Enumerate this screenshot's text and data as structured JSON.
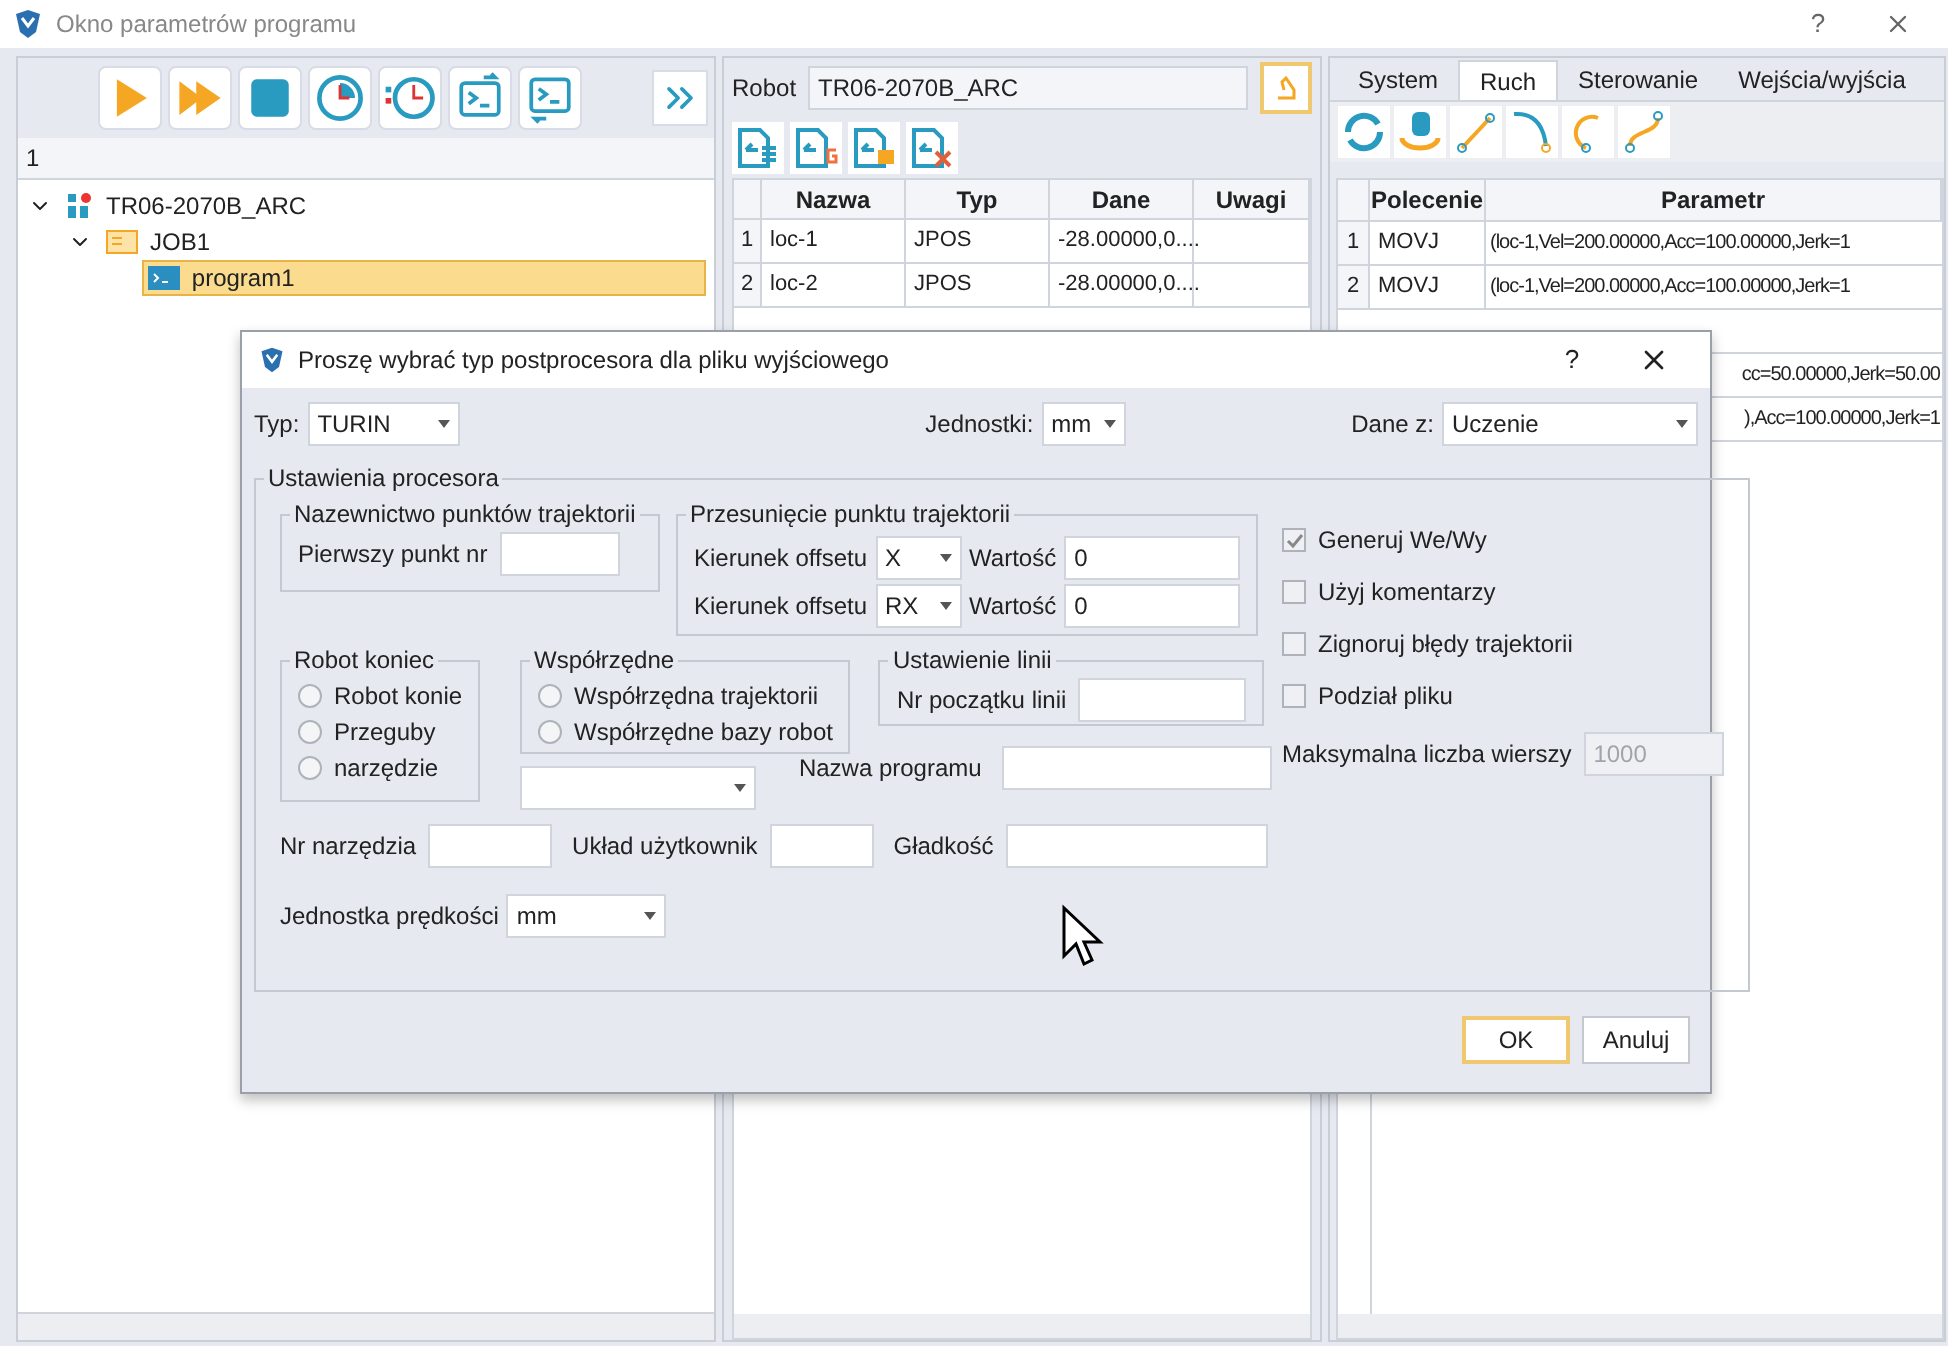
{
  "window": {
    "title": "Okno parametrów programu",
    "help": "?"
  },
  "left_panel": {
    "field": "1",
    "tree": [
      {
        "label": "TR06-2070B_ARC",
        "kind": "robot",
        "expanded": true,
        "selected": false,
        "children": [
          {
            "label": "JOB1",
            "kind": "folder",
            "expanded": true,
            "selected": false,
            "children": [
              {
                "label": "program1",
                "kind": "program",
                "selected": true
              }
            ]
          }
        ]
      }
    ]
  },
  "middle_panel": {
    "robot_label": "Robot",
    "robot_value": "TR06-2070B_ARC",
    "columns": [
      "Nazwa",
      "Typ",
      "Dane",
      "Uwagi"
    ],
    "rows": [
      {
        "number": "1",
        "cells": [
          "loc-1",
          "JPOS",
          "-28.00000,0...."
        ]
      },
      {
        "number": "2",
        "cells": [
          "loc-2",
          "JPOS",
          "-28.00000,0...."
        ]
      }
    ]
  },
  "right_panel": {
    "tabs": [
      {
        "label": "System",
        "selected": false
      },
      {
        "label": "Ruch",
        "selected": true
      },
      {
        "label": "Sterowanie",
        "selected": false
      },
      {
        "label": "Wejścia/wyjścia",
        "selected": false
      }
    ],
    "columns": [
      "Polecenie",
      "Parametr"
    ],
    "rows": [
      {
        "number": "1",
        "command": "MOVJ",
        "param": "(loc-1,Vel=200.00000,Acc=100.00000,Jerk=1"
      },
      {
        "number": "2",
        "command": "MOVJ",
        "param": "(loc-1,Vel=200.00000,Acc=100.00000,Jerk=1"
      }
    ],
    "hidden_rows": [
      "cc=50.00000,Jerk=50.00",
      "),Acc=100.00000,Jerk=1"
    ]
  },
  "dialog": {
    "title": "Proszę wybrać typ postprocesora dla pliku wyjściowego",
    "help": "?",
    "typ": {
      "label": "Typ:",
      "value": "TURIN"
    },
    "jednostki": {
      "label": "Jednostki:",
      "value": "mm"
    },
    "dane_z": {
      "label": "Dane z:",
      "value": "Uczenie"
    },
    "group_title": "Ustawienia procesora",
    "naming": {
      "title": "Nazewnictwo punktów trajektorii",
      "label": "Pierwszy punkt nr"
    },
    "offset": {
      "title": "Przesunięcie punktu trajektorii",
      "rows": [
        {
          "label": "Kierunek offsetu",
          "axis": "X",
          "value_label": "Wartość",
          "value": "0"
        },
        {
          "label": "Kierunek offsetu",
          "axis": "RX",
          "value_label": "Wartość",
          "value": "0"
        }
      ]
    },
    "robot_end": {
      "title": "Robot koniec",
      "options": [
        {
          "label": "Robot konie",
          "selected": false
        },
        {
          "label": "Przeguby",
          "selected": false
        },
        {
          "label": "narzędzie",
          "selected": false
        }
      ]
    },
    "coords": {
      "title": "Współrzędne",
      "options": [
        {
          "label": "Współrzędna trajektorii",
          "selected": false
        },
        {
          "label": "Współrzędne bazy robot",
          "selected": false
        }
      ]
    },
    "line": {
      "title": "Ustawienie linii",
      "label": "Nr początku linii"
    },
    "program_name_label": "Nazwa programu",
    "tool_label": "Nr narzędzia",
    "user_frame_label": "Układ użytkownik",
    "smooth_label": "Gładkość",
    "speed_unit": {
      "label": "Jednostka prędkości",
      "value": "mm"
    },
    "checks": [
      {
        "label": "Generuj We/Wy",
        "checked": true
      },
      {
        "label": "Użyj komentarzy",
        "checked": false
      },
      {
        "label": "Zignoruj błędy trajektorii",
        "checked": false
      },
      {
        "label": "Podział pliku",
        "checked": false
      }
    ],
    "max_rows": {
      "label": "Maksymalna liczba wierszy",
      "value": "1000",
      "disabled": true
    },
    "buttons": [
      {
        "label": "OK",
        "kind": "default"
      },
      {
        "label": "Anuluj",
        "kind": "normal"
      }
    ]
  }
}
